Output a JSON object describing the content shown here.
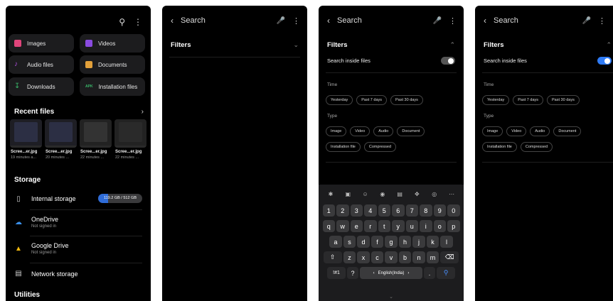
{
  "colors": {
    "accent": "#2f6cd8",
    "toggle_on": "#2f7bf5",
    "toggle_off": "#555555"
  },
  "home": {
    "categories": [
      {
        "label": "Images",
        "icon": "image-icon",
        "color": "#e0457b"
      },
      {
        "label": "Videos",
        "icon": "video-icon",
        "color": "#8a4be0"
      },
      {
        "label": "Audio files",
        "icon": "music-icon",
        "color": "#b04fe0"
      },
      {
        "label": "Documents",
        "icon": "document-icon",
        "color": "#e2a03a"
      },
      {
        "label": "Downloads",
        "icon": "download-icon",
        "color": "#3ab86a"
      },
      {
        "label": "Installation files",
        "icon": "apk-icon",
        "color": "#3ab86a",
        "badge": "APK"
      }
    ],
    "recent_title": "Recent files",
    "recent_files": [
      {
        "name": "Scree...er.jpg",
        "meta": "19 minutes a..."
      },
      {
        "name": "Scree...er.jpg",
        "meta": "20 minutes ..."
      },
      {
        "name": "Scree...er.jpg",
        "meta": "22 minutes ..."
      },
      {
        "name": "Scree...er.jpg",
        "meta": "22 minutes ..."
      }
    ],
    "storage_title": "Storage",
    "storage": [
      {
        "label": "Internal storage",
        "icon": "phone-icon",
        "usage": "119.2 GB / 512 GB",
        "used_fraction": 0.23
      },
      {
        "label": "OneDrive",
        "icon": "cloud-icon",
        "sub": "Not signed in"
      },
      {
        "label": "Google Drive",
        "icon": "google-drive-icon",
        "sub": "Not signed in"
      },
      {
        "label": "Network storage",
        "icon": "server-icon"
      }
    ],
    "utilities_title": "Utilities"
  },
  "search": {
    "title": "Search",
    "filters_label": "Filters",
    "search_inside_files": "Search inside files",
    "time_label": "Time",
    "time_chips": [
      "Yesterday",
      "Past 7 days",
      "Past 30 days"
    ],
    "type_label": "Type",
    "type_chips_row1": [
      "Image",
      "Video",
      "Audio",
      "Document"
    ],
    "type_chips_row2": [
      "Installation file",
      "Compressed"
    ]
  },
  "keyboard": {
    "numbers": [
      "1",
      "2",
      "3",
      "4",
      "5",
      "6",
      "7",
      "8",
      "9",
      "0"
    ],
    "row1": [
      "q",
      "w",
      "e",
      "r",
      "t",
      "y",
      "u",
      "i",
      "o",
      "p"
    ],
    "row2": [
      "a",
      "s",
      "d",
      "f",
      "g",
      "h",
      "j",
      "k",
      "l"
    ],
    "row3": [
      "z",
      "x",
      "c",
      "v",
      "b",
      "n",
      "m"
    ],
    "symbols_label": "!#1",
    "question": "?",
    "space_label": "English(India)",
    "period": "."
  }
}
